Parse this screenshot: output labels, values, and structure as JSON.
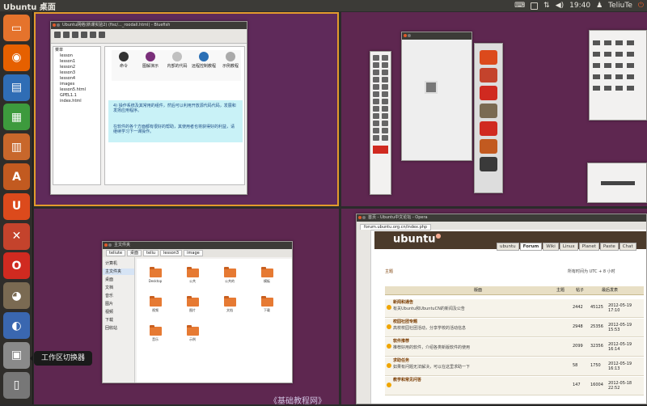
{
  "topbar": {
    "title": "Ubuntu 桌面",
    "time": "19:40",
    "user": "TeliuTe"
  },
  "launcher": {
    "items": [
      {
        "name": "home-folder",
        "color": "#e5732c",
        "glyph": "▭"
      },
      {
        "name": "firefox",
        "color": "#e66000",
        "glyph": "◉"
      },
      {
        "name": "writer",
        "color": "#2f6db5",
        "glyph": "▤"
      },
      {
        "name": "calc",
        "color": "#3d9a3d",
        "glyph": "▦"
      },
      {
        "name": "impress",
        "color": "#c8672b",
        "glyph": "▥"
      },
      {
        "name": "software-center",
        "color": "#c25a20",
        "glyph": "A"
      },
      {
        "name": "ubuntu-one",
        "color": "#dc4a1c",
        "glyph": "U"
      },
      {
        "name": "system-settings",
        "color": "#c4432c",
        "glyph": "✕"
      },
      {
        "name": "opera",
        "color": "#d02a20",
        "glyph": "O"
      },
      {
        "name": "gimp",
        "color": "#7a6a52",
        "glyph": "◕"
      },
      {
        "name": "media",
        "color": "#3a67b0",
        "glyph": "◐"
      },
      {
        "name": "workspace-switcher",
        "color": "#8a8a8a",
        "glyph": "▣"
      },
      {
        "name": "trash",
        "color": "#777",
        "glyph": "▯"
      }
    ],
    "tooltip": "工作区切换器"
  },
  "workspace1": {
    "window_title": "Ubuntu网络(新课实验2) (fisc/..._roodall.html) - Bluefish",
    "sidebar_items": [
      "菜单",
      "lesson",
      "lesson1",
      "lesson2",
      "lesson3",
      "lesson4",
      "images",
      "lesson5.html",
      "GPEL1.1",
      "index.html"
    ],
    "icon_labels": [
      "命令",
      "图解演示",
      "内部的代码",
      "远程控制教程",
      "示例教程"
    ],
    "body_text": "4) 操作系统及其常用的组件，然后可以利用开放源代码代码，发展和发扬应用程序。",
    "body_text2": "在软件的各个方面都有很好的帮助，其使用者也将获得好的利益，请继续学习下一课操作。"
  },
  "workspace3": {
    "window_title": "主文件夹",
    "path": [
      "teliute",
      "桌面",
      "teliu",
      "lesson3",
      "image"
    ],
    "sidebar": [
      "计算机",
      "主文件夹",
      "桌面",
      "文档",
      "音乐",
      "图片",
      "视频",
      "下载",
      "回收站"
    ],
    "folders": [
      "Desktop",
      "公共",
      "公共的",
      "模板",
      "视频",
      "图片",
      "文档",
      "下载",
      "音乐",
      "示例"
    ]
  },
  "workspace4": {
    "window_title": "首页 - Ubuntu中文论坛 - Opera",
    "url": "forum.ubuntu.org.cn/index.php",
    "logo": "ubuntu",
    "tabs": [
      "ubuntu",
      "Forum",
      "Wiki",
      "Linux",
      "Planet",
      "Paste",
      "Chat"
    ],
    "date_line": "所有时间为 UTC + 8 小时",
    "section": "主题",
    "headers": [
      "版面",
      "主题",
      "帖子",
      "最后发表"
    ],
    "rows": [
      {
        "title": "新闻和通告",
        "desc": "有关Ubuntu和UbuntuCN的新闻及公告",
        "topics": "2442",
        "posts": "45125",
        "last": "2012-05-19 17:10"
      },
      {
        "title": "校园社团专题",
        "desc": "高校校园社团活动，分享学校的活动信息",
        "topics": "2948",
        "posts": "25356",
        "last": "2012-05-19 15:53"
      },
      {
        "title": "软件推荐",
        "desc": "推荐好用的软件，介绍各类新版软件的使用",
        "topics": "2099",
        "posts": "32356",
        "last": "2012-05-19 16:14"
      },
      {
        "title": "求助任务",
        "desc": "如果有问题无法解决，可以在这里求助一下",
        "topics": "58",
        "posts": "1750",
        "last": "2012-05-19 16:13"
      },
      {
        "title": "教学和常见问答",
        "desc": "",
        "topics": "147",
        "posts": "16004",
        "last": "2012-05-18 22:52"
      }
    ]
  },
  "watermark": "《基础教程网》",
  "colors": {
    "workspace_bg": "#5e2750",
    "active_border": "#e29b2c",
    "panel": "#3c3b37"
  }
}
